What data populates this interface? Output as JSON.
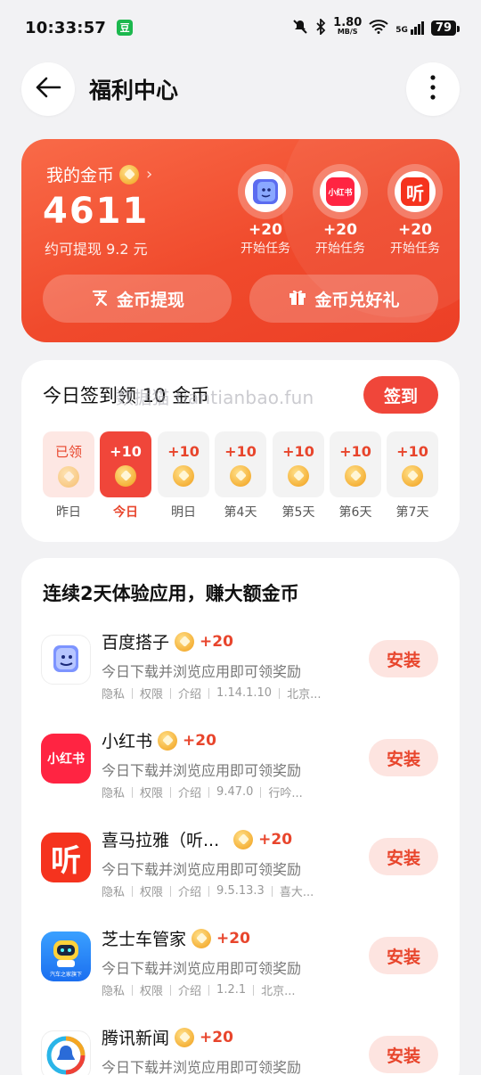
{
  "status_bar": {
    "time": "10:33:57",
    "app_badge": "豆",
    "speed_value": "1.80",
    "speed_unit": "MB/S",
    "network": "5G",
    "battery": "79"
  },
  "header": {
    "title": "福利中心"
  },
  "coin_card": {
    "label": "我的金币",
    "amount": "4611",
    "withdraw_hint": "约可提现 9.2 元",
    "tasks": [
      {
        "app": "百度搭子",
        "reward": "+20",
        "caption": "开始任务"
      },
      {
        "app": "小红书",
        "reward": "+20",
        "caption": "开始任务"
      },
      {
        "app": "喜马拉雅",
        "reward": "+20",
        "caption": "开始任务"
      }
    ],
    "withdraw_button": "金币提现",
    "gift_button": "金币兑好礼"
  },
  "signin": {
    "title": "今日签到领 10 金币",
    "button": "签到",
    "watermark": "数据猫 tiantianbao.fun",
    "days": [
      {
        "value": "已领",
        "label": "昨日",
        "state": "claimed"
      },
      {
        "value": "+10",
        "label": "今日",
        "state": "today"
      },
      {
        "value": "+10",
        "label": "明日",
        "state": "future"
      },
      {
        "value": "+10",
        "label": "第4天",
        "state": "future"
      },
      {
        "value": "+10",
        "label": "第5天",
        "state": "future"
      },
      {
        "value": "+10",
        "label": "第6天",
        "state": "future"
      },
      {
        "value": "+10",
        "label": "第7天",
        "state": "future"
      }
    ]
  },
  "apps": {
    "title": "连续2天体验应用，赚大额金币",
    "install_label": "安装",
    "items": [
      {
        "name": "百度搭子",
        "reward": "+20",
        "desc": "今日下载并浏览应用即可领奖励",
        "privacy": "隐私",
        "permission": "权限",
        "intro": "介绍",
        "version": "1.14.1.10",
        "developer": "北京..."
      },
      {
        "name": "小红书",
        "reward": "+20",
        "desc": "今日下载并浏览应用即可领奖励",
        "privacy": "隐私",
        "permission": "权限",
        "intro": "介绍",
        "version": "9.47.0",
        "developer": "行吟..."
      },
      {
        "name": "喜马拉雅（听...",
        "reward": "+20",
        "desc": "今日下载并浏览应用即可领奖励",
        "privacy": "隐私",
        "permission": "权限",
        "intro": "介绍",
        "version": "9.5.13.3",
        "developer": "喜大..."
      },
      {
        "name": "芝士车管家",
        "reward": "+20",
        "desc": "今日下载并浏览应用即可领奖励",
        "privacy": "隐私",
        "permission": "权限",
        "intro": "介绍",
        "version": "1.2.1",
        "developer": "北京..."
      },
      {
        "name": "腾讯新闻",
        "reward": "+20",
        "desc": "今日下载并浏览应用即可领奖励"
      }
    ]
  },
  "icon_labels": {
    "xiaohongshu": "小红书",
    "ximalaya": "听",
    "zhishi": "汽车之家旗下"
  },
  "colors": {
    "accent": "#f0463a",
    "card_gradient_start": "#f96a48",
    "card_gradient_end": "#ec3f26",
    "reward_red": "#e8452c",
    "background": "#f2f2f4"
  }
}
